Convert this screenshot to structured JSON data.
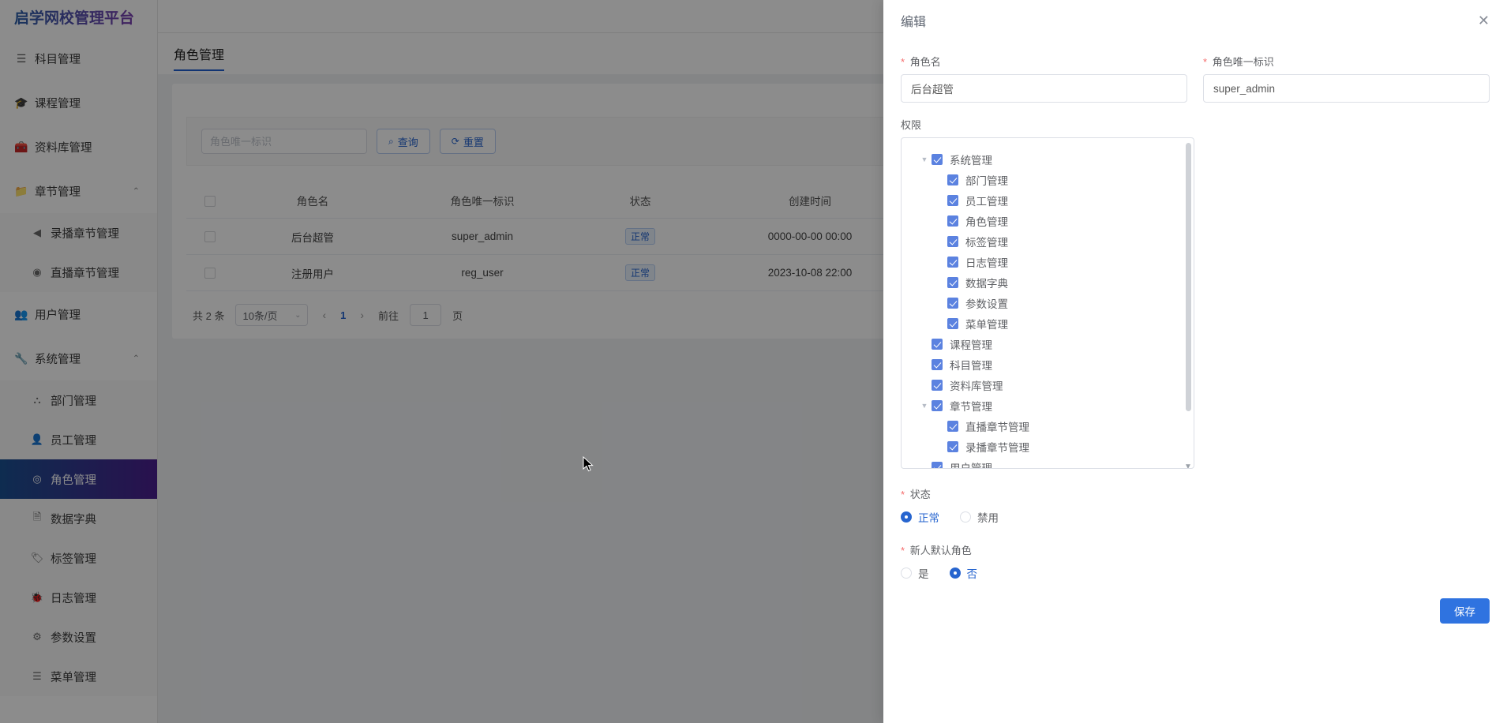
{
  "app": {
    "brand": "启学网校管理平台"
  },
  "sidebar": {
    "items": [
      {
        "label": "科目管理",
        "icon": "list-icon",
        "glyph": "☰",
        "type": "item"
      },
      {
        "label": "课程管理",
        "icon": "graduation-cap-icon",
        "glyph": "🎓",
        "type": "item"
      },
      {
        "label": "资料库管理",
        "icon": "briefcase-icon",
        "glyph": "🧰",
        "type": "item"
      },
      {
        "label": "章节管理",
        "icon": "folder-icon",
        "glyph": "📁",
        "type": "group",
        "caret": "⌃"
      },
      {
        "label": "录播章节管理",
        "icon": "play-left-icon",
        "glyph": "◀",
        "type": "sub"
      },
      {
        "label": "直播章节管理",
        "icon": "play-circle-icon",
        "glyph": "◉",
        "type": "sub"
      },
      {
        "label": "用户管理",
        "icon": "users-icon",
        "glyph": "👥",
        "type": "item"
      },
      {
        "label": "系统管理",
        "icon": "wrench-icon",
        "glyph": "🔧",
        "type": "group",
        "caret": "⌃"
      },
      {
        "label": "部门管理",
        "icon": "sitemap-icon",
        "glyph": "⛬",
        "type": "sub"
      },
      {
        "label": "员工管理",
        "icon": "person-icon",
        "glyph": "👤",
        "type": "sub"
      },
      {
        "label": "角色管理",
        "icon": "user-circle-icon",
        "glyph": "◎",
        "type": "sub",
        "active": true
      },
      {
        "label": "数据字典",
        "icon": "document-icon",
        "glyph": "🗎",
        "type": "sub"
      },
      {
        "label": "标签管理",
        "icon": "tag-icon",
        "glyph": "🏷",
        "type": "sub"
      },
      {
        "label": "日志管理",
        "icon": "bug-icon",
        "glyph": "🐞",
        "type": "sub"
      },
      {
        "label": "参数设置",
        "icon": "sliders-icon",
        "glyph": "⚙",
        "type": "sub"
      },
      {
        "label": "菜单管理",
        "icon": "menu-list-icon",
        "glyph": "☰",
        "type": "sub"
      }
    ]
  },
  "page": {
    "tab_label": "角色管理"
  },
  "search": {
    "placeholder": "角色唯一标识",
    "value": "",
    "query_label": "查询",
    "query_icon": "search-icon",
    "reset_label": "重置",
    "reset_icon": "refresh-icon"
  },
  "table": {
    "columns": [
      "",
      "角色名",
      "角色唯一标识",
      "状态",
      "创建时间"
    ],
    "rows": [
      {
        "name": "后台超管",
        "key": "super_admin",
        "status": "正常",
        "created": "0000-00-00 00:00"
      },
      {
        "name": "注册用户",
        "key": "reg_user",
        "status": "正常",
        "created": "2023-10-08 22:00"
      }
    ]
  },
  "pagination": {
    "total_text": "共 2 条",
    "page_size": "10条/页",
    "prev_icon": "chevron-left-icon",
    "next_icon": "chevron-right-icon",
    "current_page": "1",
    "goto_label": "前往",
    "goto_value": "1",
    "page_unit": "页"
  },
  "drawer": {
    "title": "编辑",
    "close_icon": "close-icon",
    "fields": {
      "role_name_label": "角色名",
      "role_name_value": "后台超管",
      "role_key_label": "角色唯一标识",
      "role_key_value": "super_admin"
    },
    "permission_label": "权限",
    "permission_tree": [
      {
        "label": "系统管理",
        "level": 1,
        "expandable": true,
        "checked": true
      },
      {
        "label": "部门管理",
        "level": 2,
        "expandable": false,
        "checked": true
      },
      {
        "label": "员工管理",
        "level": 2,
        "expandable": false,
        "checked": true
      },
      {
        "label": "角色管理",
        "level": 2,
        "expandable": false,
        "checked": true
      },
      {
        "label": "标签管理",
        "level": 2,
        "expandable": false,
        "checked": true
      },
      {
        "label": "日志管理",
        "level": 2,
        "expandable": false,
        "checked": true
      },
      {
        "label": "数据字典",
        "level": 2,
        "expandable": false,
        "checked": true
      },
      {
        "label": "参数设置",
        "level": 2,
        "expandable": false,
        "checked": true
      },
      {
        "label": "菜单管理",
        "level": 2,
        "expandable": false,
        "checked": true
      },
      {
        "label": "课程管理",
        "level": 1,
        "expandable": false,
        "checked": true
      },
      {
        "label": "科目管理",
        "level": 1,
        "expandable": false,
        "checked": true
      },
      {
        "label": "资料库管理",
        "level": 1,
        "expandable": false,
        "checked": true
      },
      {
        "label": "章节管理",
        "level": 1,
        "expandable": true,
        "checked": true
      },
      {
        "label": "直播章节管理",
        "level": 2,
        "expandable": false,
        "checked": true
      },
      {
        "label": "录播章节管理",
        "level": 2,
        "expandable": false,
        "checked": true
      },
      {
        "label": "用户管理",
        "level": 1,
        "expandable": false,
        "checked": true
      }
    ],
    "status": {
      "label": "状态",
      "options": [
        {
          "label": "正常",
          "selected": true
        },
        {
          "label": "禁用",
          "selected": false
        }
      ]
    },
    "default_role": {
      "label": "新人默认角色",
      "options": [
        {
          "label": "是",
          "selected": false
        },
        {
          "label": "否",
          "selected": true
        }
      ]
    },
    "save_label": "保存"
  },
  "colors": {
    "primary": "#2f73e0",
    "tree_check": "#5b82e0",
    "active_gradient_start": "#1b5192",
    "active_gradient_end": "#4b1f8e",
    "tag_text": "#2765cf"
  }
}
